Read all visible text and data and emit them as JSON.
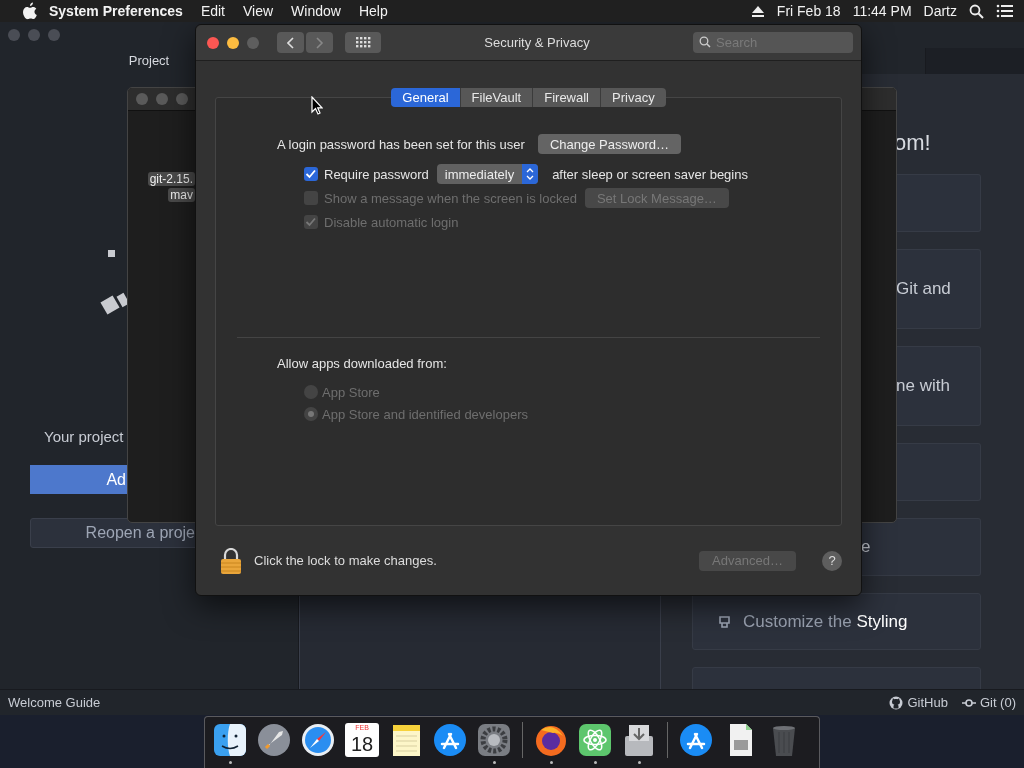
{
  "menu_bar": {
    "app_name": "System Preferences",
    "menus": [
      "Edit",
      "View",
      "Window",
      "Help"
    ],
    "date": "Fri Feb 18",
    "time": "11:44 PM",
    "user": "Dartz"
  },
  "editor_window": {
    "tree_header": "Project",
    "welcome_text": "Your project",
    "primary_button": "Ad",
    "secondary_button": "Reopen a proje",
    "guide_heading": "om!",
    "guide_cards": [
      {
        "kind": "blank"
      },
      {
        "kind": "text",
        "text": "Git and"
      },
      {
        "kind": "text",
        "text": "ne with"
      },
      {
        "kind": "blank"
      },
      {
        "kind": "text",
        "text": "e"
      },
      {
        "kind": "action",
        "text": "Customize the",
        "highlight": "Styling"
      },
      {
        "kind": "blank"
      }
    ],
    "status_bar": {
      "left": "Welcome Guide",
      "links": [
        {
          "kind": "github",
          "label": "GitHub"
        },
        {
          "kind": "git",
          "label": "Git (0)"
        }
      ]
    }
  },
  "finder_window": {
    "items": [
      "git-2.15.",
      "mav"
    ]
  },
  "prefs_window": {
    "title": "Security & Privacy",
    "search": {
      "placeholder": "Search"
    },
    "tabs": [
      {
        "label": "General",
        "selected": true
      },
      {
        "label": "FileVault",
        "selected": false
      },
      {
        "label": "Firewall",
        "selected": false
      },
      {
        "label": "Privacy",
        "selected": false
      }
    ],
    "login_text": "A login password has been set for this user",
    "change_password": "Change Password…",
    "options": [
      {
        "kind": "require",
        "label": "Require password",
        "checked": true,
        "disabled": false,
        "popup": "immediately",
        "suffix": "after sleep or screen saver begins"
      },
      {
        "kind": "message",
        "label": "Show a message when the screen is locked",
        "checked": false,
        "disabled": true,
        "button": "Set Lock Message…"
      },
      {
        "kind": "plain",
        "label": "Disable automatic login",
        "checked": true,
        "disabled": true
      }
    ],
    "allow_heading": "Allow apps downloaded from:",
    "sources": [
      {
        "label": "App Store",
        "selected": false,
        "disabled": true
      },
      {
        "label": "App Store and identified developers",
        "selected": true,
        "disabled": true
      }
    ],
    "lock_text": "Click the lock to make changes.",
    "advanced_button": {
      "label": "Advanced…",
      "disabled": true
    },
    "help": "?"
  },
  "dock": [
    {
      "kind": "finder",
      "running": true
    },
    {
      "kind": "rocket",
      "running": false
    },
    {
      "kind": "compass",
      "running": false
    },
    {
      "kind": "calendar",
      "running": false,
      "month": "FEB",
      "day": "18"
    },
    {
      "kind": "notes",
      "running": false
    },
    {
      "kind": "appstore",
      "running": false
    },
    {
      "kind": "gear",
      "running": true
    },
    {
      "kind": "separator"
    },
    {
      "kind": "firefox",
      "running": true
    },
    {
      "kind": "atom",
      "running": true
    },
    {
      "kind": "installer",
      "running": true
    },
    {
      "kind": "separator"
    },
    {
      "kind": "appstore",
      "running": false
    },
    {
      "kind": "document",
      "running": false
    },
    {
      "kind": "trash",
      "running": false
    }
  ]
}
